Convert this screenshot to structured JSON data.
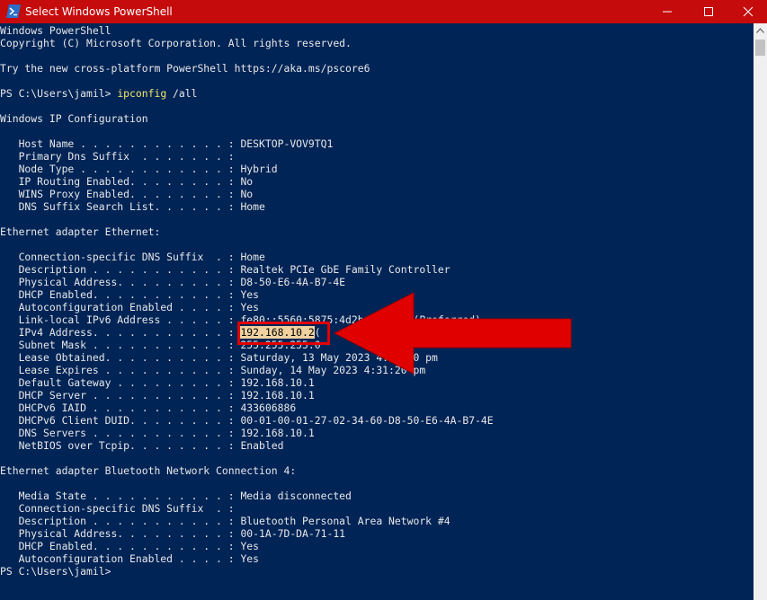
{
  "window": {
    "title": "Select Windows PowerShell",
    "accent": "#c50b0b",
    "background": "#012456",
    "icons": {
      "app": "powershell-icon",
      "minimize": "minimize-icon",
      "maximize": "maximize-icon",
      "close": "close-icon"
    }
  },
  "console": {
    "header_1": "Windows PowerShell",
    "header_2": "Copyright (C) Microsoft Corporation. All rights reserved.",
    "header_3": "Try the new cross-platform PowerShell https://aka.ms/pscore6",
    "prompt": "PS C:\\Users\\jamil> ",
    "command": "ipconfig",
    "command_args": " /all",
    "section_ip_config": "Windows IP Configuration",
    "ip_config": [
      "   Host Name . . . . . . . . . . . . : DESKTOP-VOV9TQ1",
      "   Primary Dns Suffix  . . . . . . . :",
      "   Node Type . . . . . . . . . . . . : Hybrid",
      "   IP Routing Enabled. . . . . . . . : No",
      "   WINS Proxy Enabled. . . . . . . . : No",
      "   DNS Suffix Search List. . . . . . : Home"
    ],
    "section_ethernet": "Ethernet adapter Ethernet:",
    "ethernet_top": [
      "   Connection-specific DNS Suffix  . : Home",
      "   Description . . . . . . . . . . . : Realtek PCIe GbE Family Controller",
      "   Physical Address. . . . . . . . . : D8-50-E6-4A-B7-4E",
      "   DHCP Enabled. . . . . . . . . . . : Yes",
      "   Autoconfiguration Enabled . . . . : Yes",
      "   Link-local IPv6 Address . . . . . : fe80::5560:5875:4d2b:2...%10(Preferred)"
    ],
    "ipv4_prefix": "   IPv4 Address. . . . . . . . . . . : ",
    "ipv4_value": "192.168.10.2",
    "ipv4_suffix": "(",
    "ethernet_bottom": [
      "   Subnet Mask . . . . . . . . . . . : 255.255.255.0",
      "   Lease Obtained. . . . . . . . . . : Saturday, 13 May 2023 4:31:20 pm",
      "   Lease Expires . . . . . . . . . . : Sunday, 14 May 2023 4:31:20 pm",
      "   Default Gateway . . . . . . . . . : 192.168.10.1",
      "   DHCP Server . . . . . . . . . . . : 192.168.10.1",
      "   DHCPv6 IAID . . . . . . . . . . . : 433606886",
      "   DHCPv6 Client DUID. . . . . . . . : 00-01-00-01-27-02-34-60-D8-50-E6-4A-B7-4E",
      "   DNS Servers . . . . . . . . . . . : 192.168.10.1",
      "   NetBIOS over Tcpip. . . . . . . . : Enabled"
    ],
    "section_bluetooth": "Ethernet adapter Bluetooth Network Connection 4:",
    "bluetooth": [
      "   Media State . . . . . . . . . . . : Media disconnected",
      "   Connection-specific DNS Suffix  . :",
      "   Description . . . . . . . . . . . : Bluetooth Personal Area Network #4",
      "   Physical Address. . . . . . . . . : 00-1A-7D-DA-71-11",
      "   DHCP Enabled. . . . . . . . . . . : Yes",
      "   Autoconfiguration Enabled . . . . : Yes"
    ],
    "final_prompt": "PS C:\\Users\\jamil>"
  },
  "annotation": {
    "type": "red-arrow",
    "color": "#e00000",
    "points_to": "ipv4_value"
  }
}
